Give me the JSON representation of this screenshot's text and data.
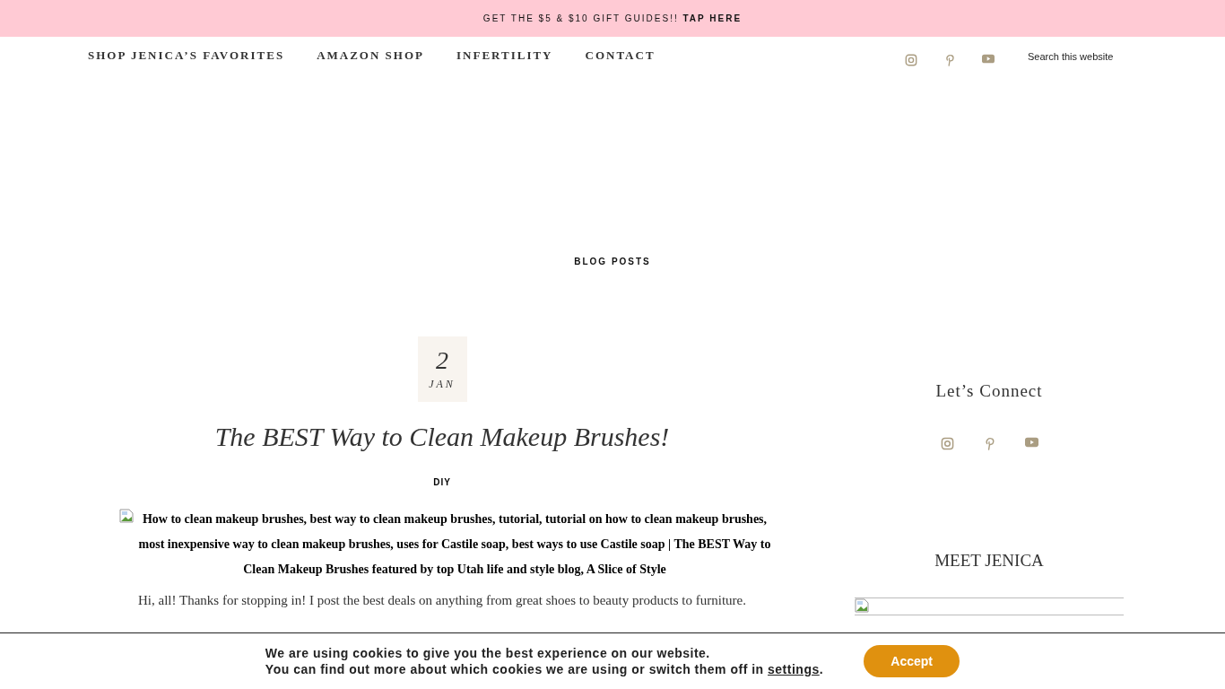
{
  "banner": {
    "text": "GET THE $5 & $10 GIFT GUIDES!! **TAP HERE**"
  },
  "nav": [
    {
      "label": "SHOP JENICA’S FAVORITES"
    },
    {
      "label": "AMAZON SHOP"
    },
    {
      "label": "INFERTILITY"
    },
    {
      "label": "CONTACT"
    }
  ],
  "search": {
    "placeholder": "Search this website"
  },
  "section_title": "BLOG POSTS",
  "post": {
    "day": "2",
    "month": "JAN",
    "title": "The BEST Way to Clean Makeup Brushes!",
    "category": "DIY",
    "image_alt": "How to clean makeup brushes, best way to clean makeup brushes, tutorial, tutorial on how to clean makeup brushes, most inexpensive way to clean makeup brushes, uses for Castile soap, best ways to use Castile soap | The BEST Way to Clean Makeup Brushes featured by top Utah life and style blog, A Slice of Style",
    "excerpt": "Hi, all! Thanks for stopping in! I post the best deals on anything from great shoes to beauty products to furniture."
  },
  "sidebar": {
    "connect_title": "Let’s Connect",
    "meet_title": "MEET JENICA"
  },
  "cookie": {
    "line1": "We are using cookies to give you the best experience on our website.",
    "line2": "You can find out more about which cookies we are using or switch them off in ",
    "link": "settings",
    "line2_end": ".",
    "button": "Accept"
  }
}
